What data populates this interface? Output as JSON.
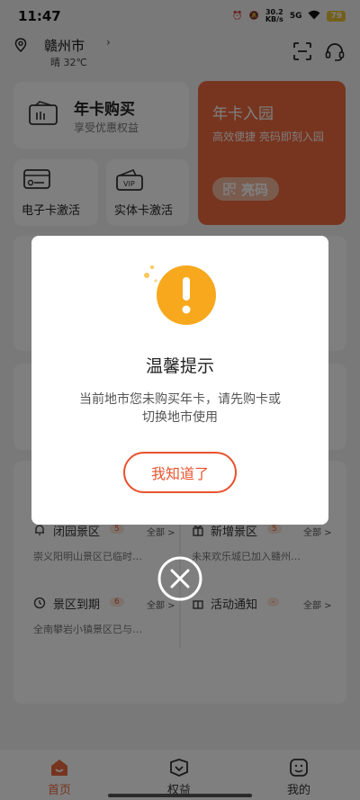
{
  "status": {
    "time": "11:47",
    "speed_value": "30.2",
    "speed_unit": "KB/s",
    "signal": "5G",
    "battery": "79"
  },
  "header": {
    "city": "赣州市",
    "weather": "晴 32℃"
  },
  "cards": {
    "annual": {
      "title": "年卡购买",
      "subtitle": "享受优惠权益"
    },
    "ecard": {
      "title": "电子卡激活"
    },
    "pcard": {
      "title": "实体卡激活"
    },
    "park": {
      "title": "年卡入园",
      "subtitle": "高效便捷 亮码即刻入园",
      "qr_label": "亮码"
    }
  },
  "messages": [
    {
      "title": "闭园景区",
      "badge": "5",
      "all": "全部 >",
      "desc": "崇义阳明山景区已临时…"
    },
    {
      "title": "新增景区",
      "badge": "5",
      "all": "全部 >",
      "desc": "未来欢乐城已加入赣州…"
    },
    {
      "title": "景区到期",
      "badge": "6",
      "all": "全部 >",
      "desc": "全南攀岩小镇景区已与…"
    },
    {
      "title": "活动通知",
      "badge": "-",
      "all": "全部 >",
      "desc": ""
    }
  ],
  "tabs": [
    {
      "label": "首页"
    },
    {
      "label": "权益"
    },
    {
      "label": "我的"
    }
  ],
  "dialog": {
    "title": "温馨提示",
    "message_line1": "当前地市您未购买年卡，请先购卡或",
    "message_line2": "切换地市使用",
    "button": "我知道了"
  },
  "colors": {
    "accent": "#ee6a3f",
    "dialog_button": "#e8542f",
    "warn_icon": "#f7a81d"
  }
}
